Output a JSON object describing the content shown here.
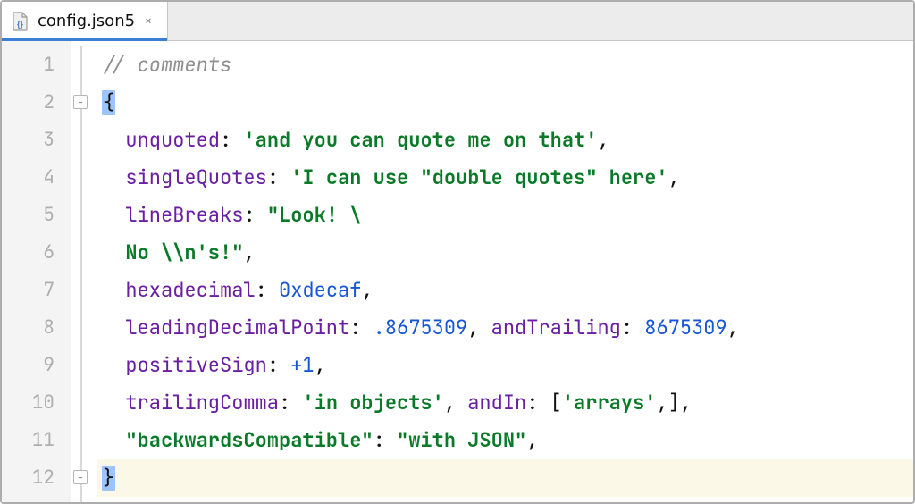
{
  "tab": {
    "filename": "config.json5",
    "close_glyph": "×"
  },
  "line_numbers": [
    "1",
    "2",
    "3",
    "4",
    "5",
    "6",
    "7",
    "8",
    "9",
    "10",
    "11",
    "12"
  ],
  "code": {
    "l1": {
      "comment_slashes": "// ",
      "comment_text": "comments"
    },
    "l2": {
      "open_brace": "{"
    },
    "l3": {
      "key": "unquoted",
      "colon": ": ",
      "string": "'and you can quote me on that'",
      "comma": ","
    },
    "l4": {
      "key": "singleQuotes",
      "colon": ": ",
      "string": "'I can use \"double quotes\" here'",
      "comma": ","
    },
    "l5": {
      "key": "lineBreaks",
      "colon": ": ",
      "string": "\"Look! \\"
    },
    "l6": {
      "string": "No \\\\n's!\"",
      "comma": ","
    },
    "l7": {
      "key": "hexadecimal",
      "colon": ": ",
      "number": "0xdecaf",
      "comma": ","
    },
    "l8": {
      "key1": "leadingDecimalPoint",
      "colon1": ": ",
      "number1": ".8675309",
      "comma1": ", ",
      "key2": "andTrailing",
      "colon2": ": ",
      "number2": "8675309",
      "comma2": ","
    },
    "l9": {
      "key": "positiveSign",
      "colon": ": ",
      "number": "+1",
      "comma": ","
    },
    "l10": {
      "key1": "trailingComma",
      "colon1": ": ",
      "string1": "'in objects'",
      "comma1": ", ",
      "key2": "andIn",
      "colon2": ": ",
      "lbracket": "[",
      "string2": "'arrays'",
      "comma2": ",",
      "rbracket": "]",
      "comma3": ","
    },
    "l11": {
      "key": "\"backwardsCompatible\"",
      "colon": ": ",
      "string": "\"with JSON\"",
      "comma": ","
    },
    "l12": {
      "close_brace": "}"
    }
  },
  "colors": {
    "accent": "#3b7fd4",
    "comment": "#909090",
    "key": "#6a1ea1",
    "string": "#0a7a28",
    "number": "#1656d8",
    "current_line": "#fbf8e8",
    "brace_match": "#9cc4ff"
  }
}
